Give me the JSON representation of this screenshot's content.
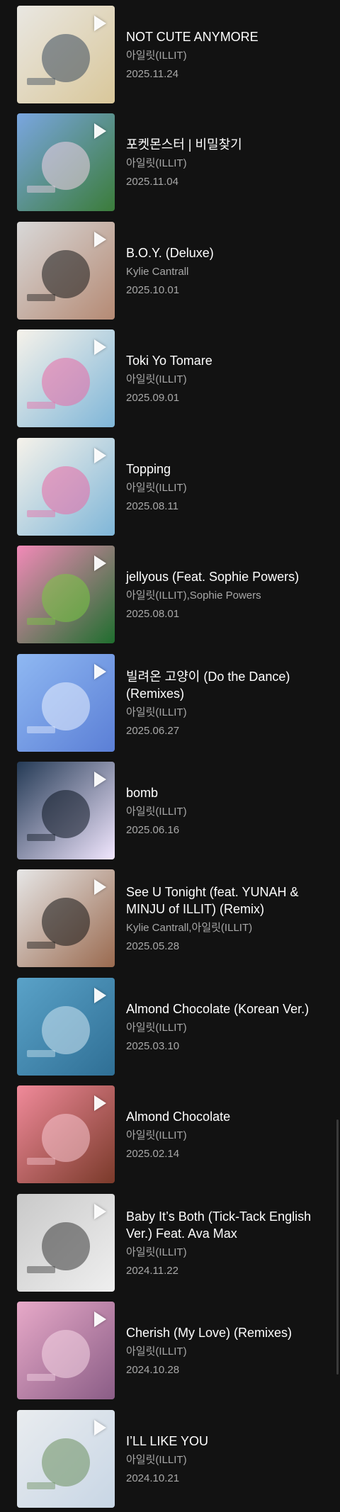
{
  "releases": [
    {
      "title": "NOT CUTE ANYMORE",
      "artist": "아일릿(ILLIT)",
      "date": "2025.11.24",
      "cover_colors": [
        "#e9e7e2",
        "#3a4a5c",
        "#d9c79a"
      ],
      "icon": "play-icon"
    },
    {
      "title": "포켓몬스터 | 비밀찾기",
      "artist": "아일릿(ILLIT)",
      "date": "2025.11.04",
      "cover_colors": [
        "#7aa6e0",
        "#f2d3e6",
        "#3b7c3a"
      ],
      "icon": "play-icon"
    },
    {
      "title": "B.O.Y. (Deluxe)",
      "artist": "Kylie Cantrall",
      "date": "2025.10.01",
      "cover_colors": [
        "#d8d8d8",
        "#1a1a1a",
        "#b58a74"
      ],
      "icon": "play-icon"
    },
    {
      "title": "Toki Yo Tomare",
      "artist": "아일릿(ILLIT)",
      "date": "2025.09.01",
      "cover_colors": [
        "#f6f2ea",
        "#e96aa6",
        "#7fb6d8"
      ],
      "icon": "play-icon"
    },
    {
      "title": "Topping",
      "artist": "아일릿(ILLIT)",
      "date": "2025.08.11",
      "cover_colors": [
        "#f6f2ea",
        "#e96aa6",
        "#7fb6d8"
      ],
      "icon": "play-icon"
    },
    {
      "title": "jellyous (Feat. Sophie Powers)",
      "artist": "아일릿(ILLIT),Sophie Powers",
      "date": "2025.08.01",
      "cover_colors": [
        "#f28ab8",
        "#7ac943",
        "#1f6e2e"
      ],
      "icon": "play-icon"
    },
    {
      "title": "빌려온 고양이 (Do the Dance) (Remixes)",
      "artist": "아일릿(ILLIT)",
      "date": "2025.06.27",
      "cover_colors": [
        "#8fb8f2",
        "#e9f0ff",
        "#5b7fd6"
      ],
      "icon": "play-icon"
    },
    {
      "title": "bomb",
      "artist": "아일릿(ILLIT)",
      "date": "2025.06.16",
      "cover_colors": [
        "#243a55",
        "#0d1622",
        "#f2e7ff"
      ],
      "icon": "play-icon"
    },
    {
      "title": "See U Tonight (feat. YUNAH & MINJU of ILLIT) (Remix)",
      "artist": "Kylie Cantrall,아일릿(ILLIT)",
      "date": "2025.05.28",
      "cover_colors": [
        "#e6e6e6",
        "#141414",
        "#9a6a4f"
      ],
      "icon": "play-icon"
    },
    {
      "title": "Almond Chocolate (Korean Ver.)",
      "artist": "아일릿(ILLIT)",
      "date": "2025.03.10",
      "cover_colors": [
        "#5aa2c8",
        "#cfe6f2",
        "#2f6f95"
      ],
      "icon": "play-icon"
    },
    {
      "title": "Almond Chocolate",
      "artist": "아일릿(ILLIT)",
      "date": "2025.02.14",
      "cover_colors": [
        "#f08a9a",
        "#f7c6cf",
        "#7a3a2a"
      ],
      "icon": "play-icon"
    },
    {
      "title": "Baby It’s Both (Tick-Tack English Ver.) Feat. Ava Max",
      "artist": "아일릿(ILLIT)",
      "date": "2024.11.22",
      "cover_colors": [
        "#c9c9c9",
        "#3a3a3a",
        "#efefef"
      ],
      "icon": "play-icon"
    },
    {
      "title": "Cherish (My Love) (Remixes)",
      "artist": "아일릿(ILLIT)",
      "date": "2024.10.28",
      "cover_colors": [
        "#e7a9c8",
        "#f6d7e6",
        "#8a5d86"
      ],
      "icon": "play-icon"
    },
    {
      "title": "I’LL LIKE YOU",
      "artist": "아일릿(ILLIT)",
      "date": "2024.10.21",
      "cover_colors": [
        "#e9ecef",
        "#6b8f5e",
        "#c8d6e5"
      ],
      "icon": "play-icon"
    }
  ]
}
